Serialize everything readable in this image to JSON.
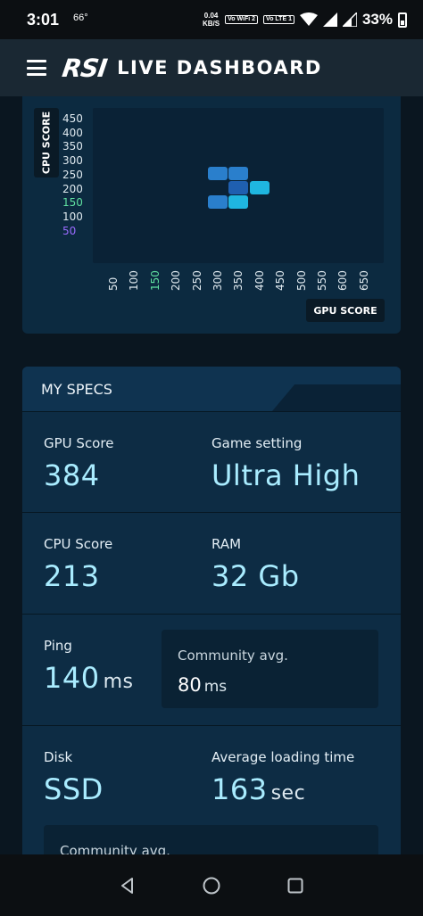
{
  "status_bar": {
    "time": "3:01",
    "temperature": "66°",
    "speed_value": "0.04",
    "speed_unit": "KB/S",
    "badge_wifi": "Vo WiFi 2",
    "badge_lte": "Vo LTE 1",
    "battery_pct": "33%"
  },
  "header": {
    "logo": "RSI",
    "title": "LIVE DASHBOARD",
    "menu_icon": "hamburger-menu-icon"
  },
  "chart_data": {
    "type": "heatmap",
    "ylabel": "CPU SCORE",
    "xlabel": "GPU SCORE",
    "y_ticks": [
      "450",
      "400",
      "350",
      "300",
      "250",
      "200",
      "150",
      "100",
      "50"
    ],
    "x_ticks": [
      "50",
      "100",
      "150",
      "200",
      "250",
      "300",
      "350",
      "400",
      "450",
      "500",
      "550",
      "600",
      "650"
    ],
    "highlighted_y_tick": "150",
    "highlighted_x_tick": "150",
    "purple_y_tick": "50",
    "cells": [
      {
        "x": 300,
        "y": 250,
        "color": "#2a7fcc"
      },
      {
        "x": 350,
        "y": 250,
        "color": "#2a7fcc"
      },
      {
        "x": 350,
        "y": 200,
        "color": "#1f5fb0"
      },
      {
        "x": 400,
        "y": 200,
        "color": "#1fb6e0"
      },
      {
        "x": 300,
        "y": 150,
        "color": "#2a7fcc"
      },
      {
        "x": 350,
        "y": 150,
        "color": "#1fb6e0"
      }
    ],
    "colors": {
      "highlight_green": "#5fe0a0",
      "highlight_purple": "#9a6bff"
    }
  },
  "specs": {
    "title": "MY SPECS",
    "gpu_label": "GPU Score",
    "gpu_value": "384",
    "game_setting_label": "Game setting",
    "game_setting_value": "Ultra High",
    "cpu_label": "CPU Score",
    "cpu_value": "213",
    "ram_label": "RAM",
    "ram_value": "32 Gb",
    "ping_label": "Ping",
    "ping_value": "140",
    "ping_unit": "ms",
    "ping_avg_label": "Community avg.",
    "ping_avg_value": "80",
    "ping_avg_unit": "ms",
    "disk_label": "Disk",
    "disk_value": "SSD",
    "loading_label": "Average loading time",
    "loading_value": "163",
    "loading_unit": "sec",
    "loading_avg_label": "Community avg."
  },
  "nav": {
    "back_icon": "back-triangle-icon",
    "home_icon": "home-circle-icon",
    "recents_icon": "recents-square-icon"
  }
}
